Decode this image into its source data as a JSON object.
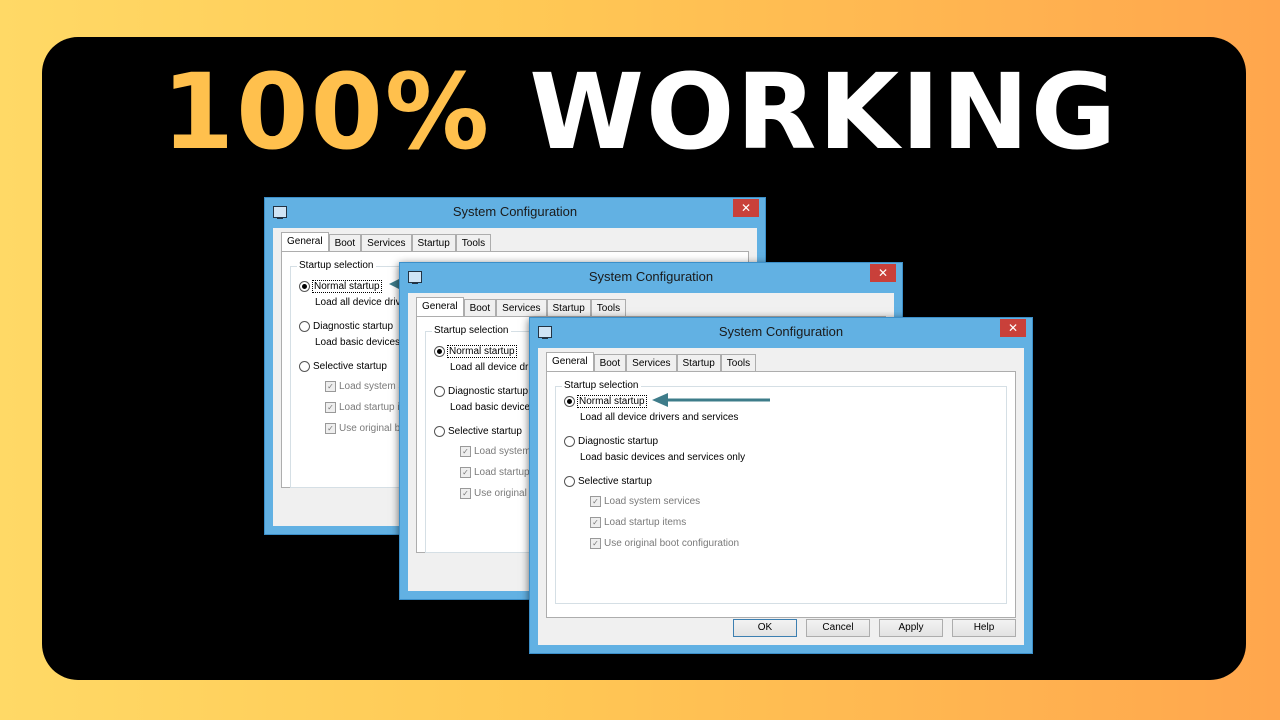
{
  "headline": {
    "part1": "100%",
    "part2": "WORKING"
  },
  "dialog": {
    "title": "System Configuration",
    "close_glyph": "✕",
    "tabs": [
      "General",
      "Boot",
      "Services",
      "Startup",
      "Tools"
    ],
    "group_label": "Startup selection",
    "normal_startup": "Normal startup",
    "normal_desc": "Load all device drivers and services",
    "diagnostic_startup": "Diagnostic startup",
    "diagnostic_desc": "Load basic devices and services only",
    "selective_startup": "Selective startup",
    "load_system_services": "Load system services",
    "load_startup_items": "Load startup items",
    "use_original_boot": "Use original boot configuration",
    "buttons": {
      "ok": "OK",
      "cancel": "Cancel",
      "apply": "Apply",
      "help": "Help"
    },
    "selected_option": "normal_startup"
  },
  "icons": {
    "app": "system-config-icon",
    "close": "close-icon",
    "arrow": "pointer-arrow-icon",
    "check": "✓"
  },
  "colors": {
    "panel": "#000000",
    "headline_accent": "#ffc04d",
    "headline_white": "#ffffff",
    "window_frame": "#62b1e3",
    "close_button": "#c9403a",
    "arrow": "#3e7c8a"
  }
}
